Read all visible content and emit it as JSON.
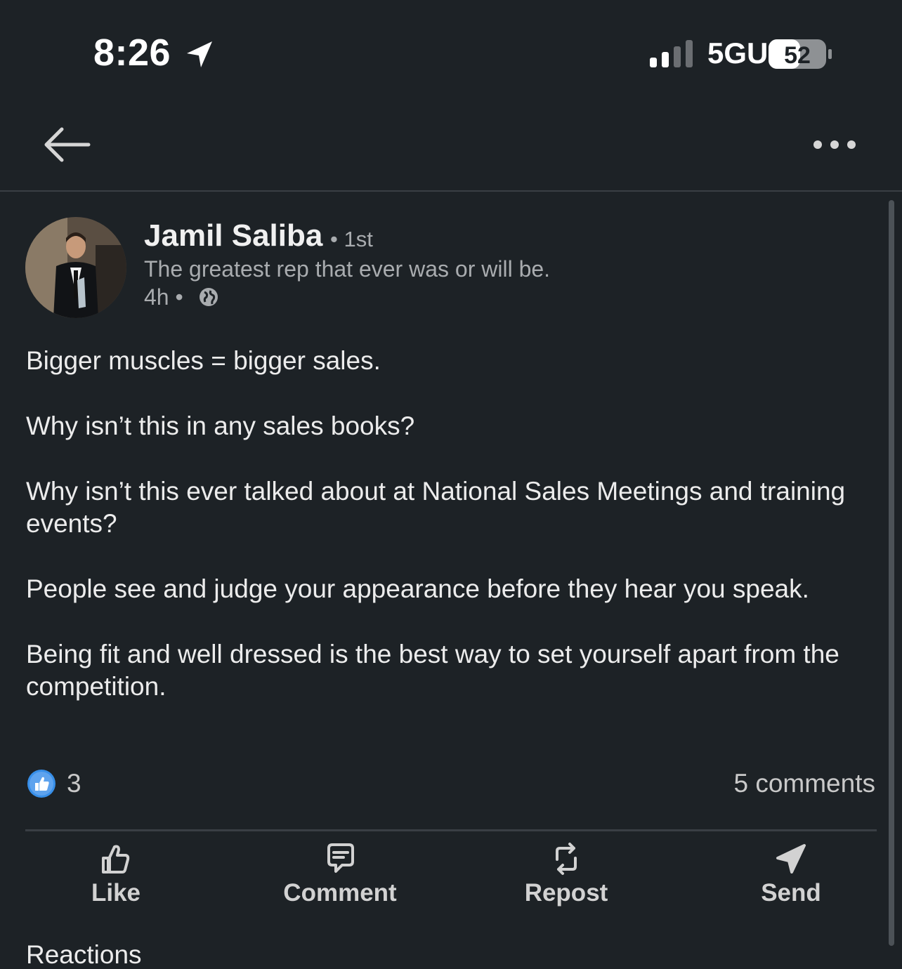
{
  "status_bar": {
    "time": "8:26",
    "network": "5GUC",
    "battery": "52",
    "icons": [
      "location-arrow-icon",
      "signal-bars-icon",
      "battery-icon"
    ]
  },
  "nav": {
    "back_icon": "back-arrow-icon",
    "more_icon": "more-dots-icon"
  },
  "post": {
    "author": "Jamil Saliba",
    "degree": "• 1st",
    "headline": "The greatest rep that ever was or will be.",
    "time": "4h •",
    "visibility_icon": "globe-icon",
    "paragraphs": [
      "Bigger muscles = bigger sales.",
      "Why isn’t this in any sales books?",
      "Why isn’t this ever talked about at National Sales Meetings and training events?",
      "People see and judge your appearance before they hear you speak.",
      "Being fit and well dressed is the best way to set yourself apart from the competition."
    ],
    "reaction_count": "3",
    "comments_count": "5 comments",
    "reaction_icon": "like-reaction-icon"
  },
  "actions": [
    {
      "label": "Like",
      "icon": "thumbs-up-icon"
    },
    {
      "label": "Comment",
      "icon": "comment-bubble-icon"
    },
    {
      "label": "Repost",
      "icon": "repost-icon"
    },
    {
      "label": "Send",
      "icon": "send-icon"
    }
  ],
  "cut_off_text": "Reactions",
  "colors": {
    "background": "#1d2226",
    "text_primary": "#e9e9e9",
    "text_secondary": "#a9acaf",
    "like_blue": "#378fe9"
  }
}
